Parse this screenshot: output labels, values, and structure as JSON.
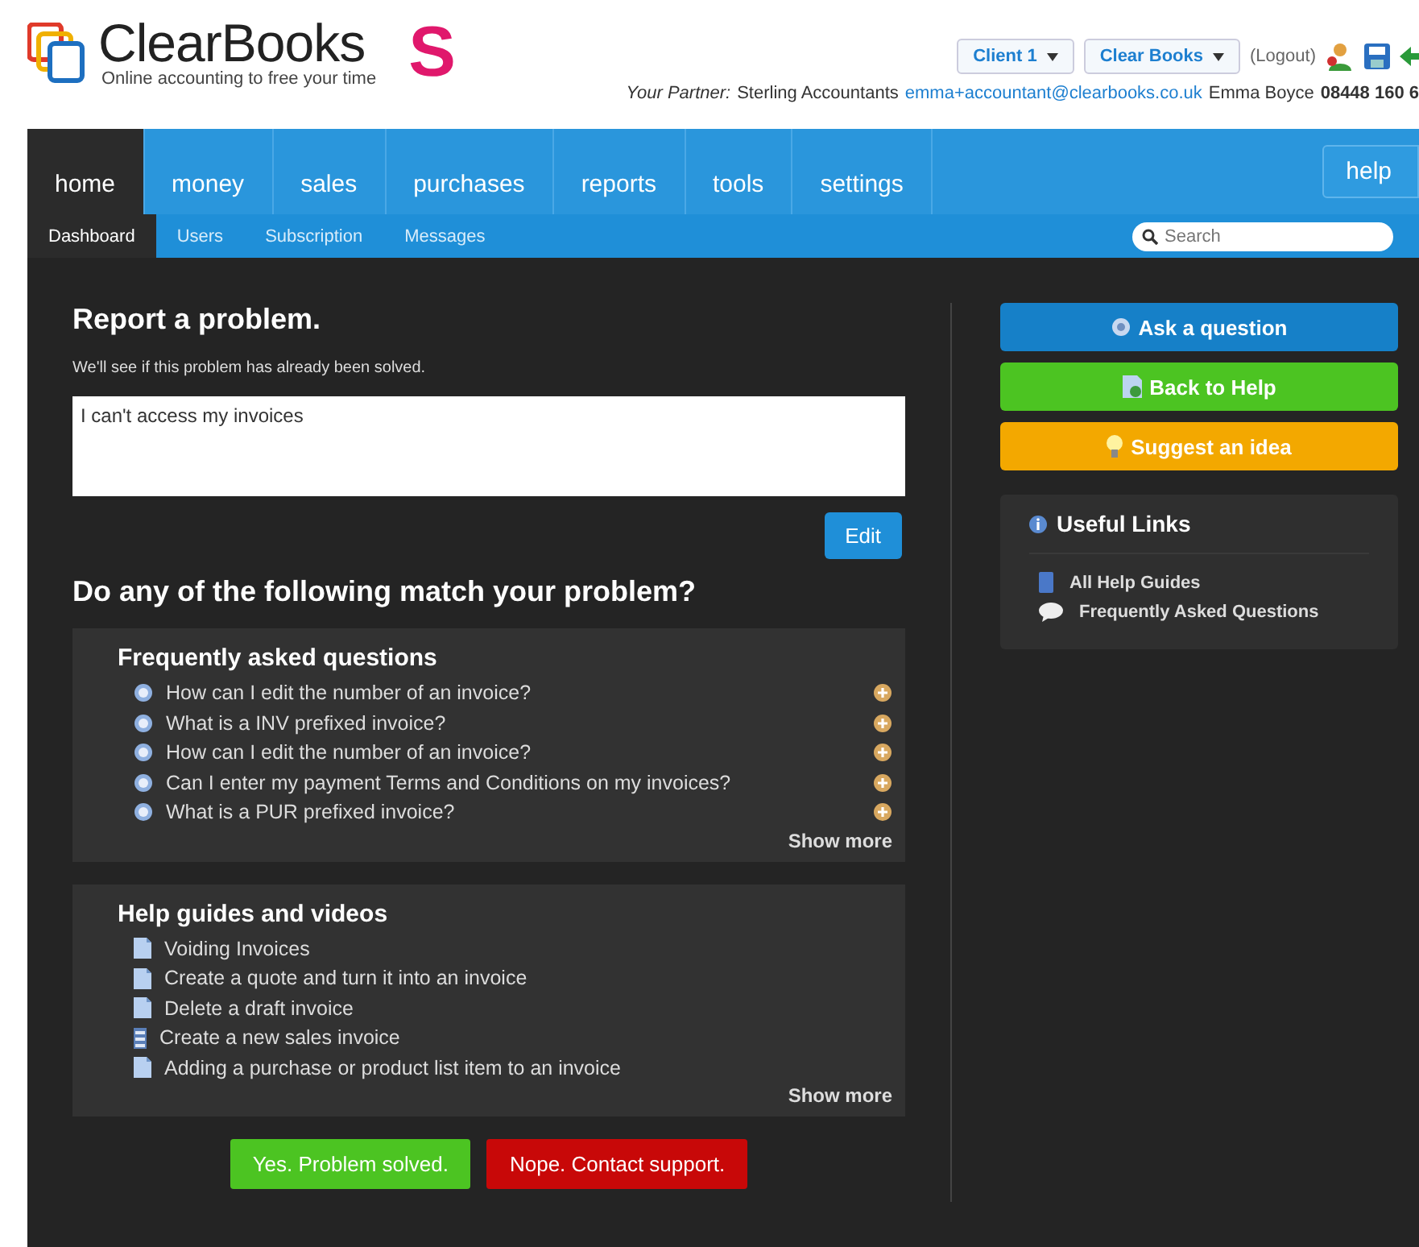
{
  "header": {
    "logo": {
      "name": "ClearBooks",
      "tagline": "Online accounting to free your time",
      "badge": "S"
    },
    "menus": [
      "Client 1",
      "Clear Books"
    ],
    "logout": "(Logout)",
    "partner": {
      "label": "Your Partner:",
      "firm": "Sterling Accountants",
      "email": "emma+accountant@clearbooks.co.uk",
      "name": "Emma Boyce",
      "phone": "08448 160 6"
    }
  },
  "nav": {
    "tabs": [
      {
        "label": "home",
        "selected": true
      },
      {
        "label": "money",
        "selected": false
      },
      {
        "label": "sales",
        "selected": false
      },
      {
        "label": "purchases",
        "selected": false
      },
      {
        "label": "reports",
        "selected": false
      },
      {
        "label": "tools",
        "selected": false
      },
      {
        "label": "settings",
        "selected": false
      }
    ],
    "help": "help"
  },
  "subnav": {
    "tabs": [
      {
        "label": "Dashboard",
        "selected": true
      },
      {
        "label": "Users",
        "selected": false
      },
      {
        "label": "Subscription",
        "selected": false
      },
      {
        "label": "Messages",
        "selected": false
      }
    ],
    "search": {
      "placeholder": "Search"
    }
  },
  "report": {
    "title": "Report a problem.",
    "subtitle": "We'll see if this problem has already been solved.",
    "problem": "I can't access my invoices",
    "edit": "Edit"
  },
  "match_title": "Do any of the following match your problem?",
  "faq": {
    "title": "Frequently asked questions",
    "items": [
      {
        "text": "How can I edit the number of an invoice?"
      },
      {
        "text": "What is a INV prefixed invoice?"
      },
      {
        "text": "How can I edit the number of an invoice?"
      },
      {
        "text": "Can I enter my payment Terms and Conditions on my invoices?"
      },
      {
        "text": "What is a PUR prefixed invoice?"
      }
    ],
    "show_more": "Show more"
  },
  "guides": {
    "title": "Help guides and videos",
    "items": [
      {
        "text": "Voiding Invoices",
        "kind": "page"
      },
      {
        "text": "Create a quote and turn it into an invoice",
        "kind": "page"
      },
      {
        "text": "Delete a draft invoice",
        "kind": "page"
      },
      {
        "text": "Create a new sales invoice",
        "kind": "list"
      },
      {
        "text": "Adding a purchase or product list item to an invoice",
        "kind": "page"
      }
    ],
    "show_more": "Show more"
  },
  "actions": [
    {
      "label": "Yes. Problem solved.",
      "kind": "success"
    },
    {
      "label": "Nope. Contact support.",
      "kind": "danger"
    }
  ],
  "sidebar": {
    "buttons": [
      {
        "label": "Ask a question",
        "kind": "ask"
      },
      {
        "label": "Back to Help",
        "kind": "help"
      },
      {
        "label": "Suggest an idea",
        "kind": "idea"
      }
    ],
    "useful_links": {
      "title": "Useful Links",
      "links": [
        {
          "label": "All Help Guides",
          "kind": "guide"
        },
        {
          "label": "Frequently Asked Questions",
          "kind": "chat"
        }
      ]
    }
  }
}
